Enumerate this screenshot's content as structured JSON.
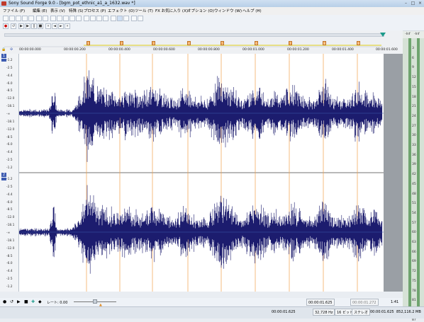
{
  "window": {
    "title": "Sony Sound Forge 9.0 - [bgm_pot_ethnic_a1_a_1632.wav *]"
  },
  "menu": [
    "ファイル (F)",
    "編集 (E)",
    "表示 (V)",
    "特殊 (S)",
    "プロセス (P)",
    "エフェクト (O)",
    "ツール (T)",
    "FX お気に入り (X)",
    "オプション (O)",
    "ウィンドウ (W)",
    "ヘルプ (H)"
  ],
  "ruler": {
    "ticks": [
      "00:00:00.000",
      "00:00:00.200",
      "00:00:00.400",
      "00:00:00.600",
      "00:00:00.800",
      "00:00:01.000",
      "00:00:01.200",
      "00:00:01.400",
      "00:00:01.600"
    ],
    "markers": [
      "1",
      "2",
      "3",
      "4",
      "5",
      "6",
      "7",
      "8",
      "9"
    ]
  },
  "channels": [
    {
      "number": "1",
      "db_labels": [
        "-1.2",
        "-2.5",
        "-4.4",
        "-6.0",
        "-8.5",
        "-12.0",
        "-18.1",
        "-∞",
        "-18.1",
        "-12.0",
        "-8.5",
        "-6.0",
        "-4.4",
        "-2.5",
        "-1.2"
      ]
    },
    {
      "number": "2",
      "db_labels": [
        "-1.2",
        "-2.5",
        "-4.4",
        "-6.0",
        "-8.5",
        "-12.0",
        "-18.1",
        "-∞",
        "-18.1",
        "-12.0",
        "-8.5",
        "-6.0",
        "-4.4",
        "-2.5",
        "-1.2"
      ]
    }
  ],
  "meter": {
    "labels": [
      "-Inf",
      "-Inf",
      "3",
      "6",
      "9",
      "12",
      "15",
      "18",
      "21",
      "24",
      "27",
      "30",
      "33",
      "36",
      "39",
      "42",
      "45",
      "48",
      "51",
      "54",
      "57",
      "60",
      "63",
      "66",
      "69",
      "72",
      "75",
      "78",
      "81",
      "84",
      "87"
    ]
  },
  "transport": {
    "rate_label": "レート: 0.00"
  },
  "status": {
    "selection_start": "00:00:01.625",
    "selection_length": "00:00:01.272",
    "zoom": "1:41",
    "end_time": "00:00:01.625",
    "sample_rate": "32,728 Hz",
    "bit_depth": "16 ビット",
    "channels": "ステレオ",
    "position": "00:00:01.625",
    "memory": "852,116.2 MB"
  },
  "colors": {
    "waveform": "#1c1c6e",
    "marker": "#f2a24a",
    "selection_gray": "#9a9fa5"
  }
}
